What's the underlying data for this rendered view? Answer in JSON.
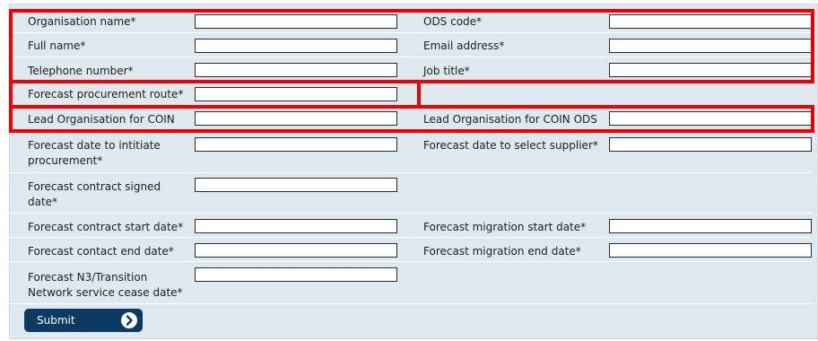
{
  "form": {
    "organisation_name_label": "Organisation name*",
    "ods_code_label": "ODS code*",
    "full_name_label": "Full name*",
    "email_label": "Email address*",
    "telephone_label": "Telephone number*",
    "job_title_label": "Job title*",
    "procurement_route_label": "Forecast procurement route*",
    "lead_org_label": "Lead Organisation for COIN",
    "lead_org_ods_label": "Lead Organisation for COIN ODS",
    "date_initiate_label": "Forecast date to intitiate procurement*",
    "date_select_supplier_label": "Forecast date to select supplier*",
    "contract_signed_label": "Forecast contract signed date*",
    "contract_start_label": "Forecast contract start date*",
    "migration_start_label": "Forecast migration start date*",
    "contact_end_label": "Forecast contact end date*",
    "migration_end_label": "Forecast migration end date*",
    "n3_cease_label": "Forecast N3/Transition Network service cease date*",
    "submit_label": "Submit"
  },
  "colors": {
    "panel_bg": "#dde9ef",
    "highlight": "#ee0000",
    "submit_bg": "#0b3a62"
  },
  "icons": {
    "submit": "chevron-right-circle-icon"
  }
}
